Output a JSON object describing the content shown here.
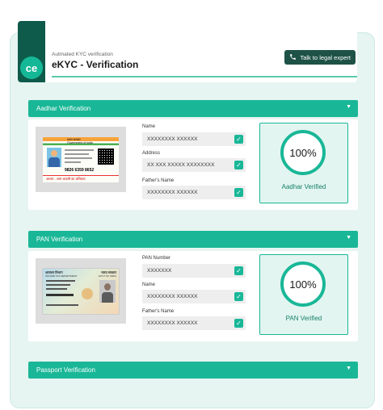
{
  "window": {
    "dot_count": 3
  },
  "header": {
    "logo_text": "ce",
    "subtitle": "Autmated KYC verification",
    "title": "eKYC - Verification",
    "talk_button": "Talk to legal expert"
  },
  "sections": {
    "aadhar": {
      "title": "Aadhar Verification",
      "fields": [
        {
          "label": "Name",
          "value": "XXXXXXXX XXXXXX"
        },
        {
          "label": "Address",
          "value": "XX XXX XXXXX XXXXXXXX"
        },
        {
          "label": "Father's Name",
          "value": "XXXXXXXX XXXXXX"
        }
      ],
      "percent": "100%",
      "status": "Aadhar Verified",
      "card": {
        "header": "भारत सरकार",
        "subheader": "Government of India",
        "number": "9826 6359 8652",
        "footer": "आधार - आम आदमी का अधिकार"
      }
    },
    "pan": {
      "title": "PAN Verification",
      "fields": [
        {
          "label": "PAN Number",
          "value": "XXXXXXX"
        },
        {
          "label": "Name",
          "value": "XXXXXXXX XXXXXX"
        },
        {
          "label": "Father's Name",
          "value": "XXXXXXXX XXXXXX"
        }
      ],
      "percent": "100%",
      "status": "PAN Verified",
      "card": {
        "header_left": "आयकर विभाग",
        "header_right": "भारत सरकार",
        "sub_left": "INCOME TAX DEPARTMENT",
        "sub_right": "GOVT OF INDIA"
      }
    },
    "passport": {
      "title": "Passport Verification"
    }
  },
  "colors": {
    "accent": "#19b797",
    "dark": "#1e5247",
    "background": "#e6f5f1"
  }
}
